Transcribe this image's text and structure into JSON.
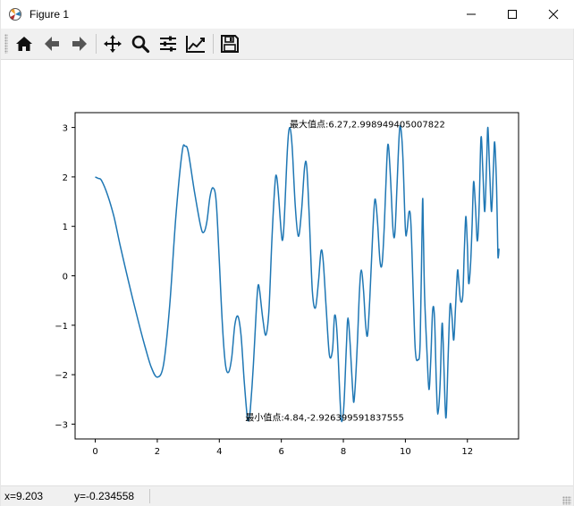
{
  "window": {
    "title": "Figure 1",
    "minimize_symbol": "—",
    "maximize_symbol": "☐",
    "close_symbol": "✕"
  },
  "toolbar": {
    "items": [
      {
        "name": "home-icon",
        "tooltip": ""
      },
      {
        "name": "back-arrow-icon",
        "tooltip": ""
      },
      {
        "name": "forward-arrow-icon",
        "tooltip": ""
      },
      {
        "name": "pan-icon",
        "tooltip": ""
      },
      {
        "name": "zoom-icon",
        "tooltip": ""
      },
      {
        "name": "subplots-config-icon",
        "tooltip": ""
      },
      {
        "name": "edit-axis-icon",
        "tooltip": ""
      },
      {
        "name": "save-icon",
        "tooltip": ""
      }
    ]
  },
  "colors": {
    "line": "#1f77b4",
    "toolbar_bg": "#f0f0f0",
    "axis": "#000000"
  },
  "chart_data": {
    "type": "line",
    "title": "",
    "xlabel": "",
    "ylabel": "",
    "xlim": [
      -0.65,
      13.65
    ],
    "ylim": [
      -3.3,
      3.3
    ],
    "xticks": [
      0,
      2,
      4,
      6,
      8,
      10,
      12
    ],
    "xtick_labels": [
      "0",
      "2",
      "4",
      "6",
      "8",
      "10",
      "12"
    ],
    "yticks": [
      -3,
      -2,
      -1,
      0,
      1,
      2,
      3
    ],
    "ytick_labels": [
      "−3",
      "−2",
      "−1",
      "0",
      "1",
      "2",
      "3"
    ],
    "grid": false,
    "series": [
      {
        "function": "2*cos(x^2/4)+cos(x*x/... )",
        "x_range": [
          0,
          13
        ],
        "points": [
          [
            0.0,
            2.0
          ],
          [
            0.1,
            1.97
          ],
          [
            0.2,
            1.93
          ],
          [
            0.4,
            1.63
          ],
          [
            0.6,
            1.2
          ],
          [
            0.8,
            0.62
          ],
          [
            1.0,
            0.08
          ],
          [
            1.2,
            -0.45
          ],
          [
            1.4,
            -0.95
          ],
          [
            1.6,
            -1.42
          ],
          [
            1.8,
            -1.84
          ],
          [
            2.0,
            -2.05
          ],
          [
            2.2,
            -1.8
          ],
          [
            2.4,
            -0.6
          ],
          [
            2.6,
            1.2
          ],
          [
            2.8,
            2.5
          ],
          [
            2.9,
            2.62
          ],
          [
            3.0,
            2.5
          ],
          [
            3.2,
            1.7
          ],
          [
            3.4,
            1.0
          ],
          [
            3.5,
            0.88
          ],
          [
            3.6,
            1.1
          ],
          [
            3.7,
            1.6
          ],
          [
            3.8,
            1.78
          ],
          [
            3.9,
            1.5
          ],
          [
            4.0,
            0.3
          ],
          [
            4.1,
            -1.0
          ],
          [
            4.2,
            -1.8
          ],
          [
            4.3,
            -1.95
          ],
          [
            4.4,
            -1.65
          ],
          [
            4.5,
            -1.0
          ],
          [
            4.6,
            -0.82
          ],
          [
            4.7,
            -1.2
          ],
          [
            4.8,
            -2.1
          ],
          [
            4.9,
            -2.85
          ],
          [
            4.95,
            -2.9
          ],
          [
            5.0,
            -2.7
          ],
          [
            5.1,
            -1.8
          ],
          [
            5.2,
            -0.6
          ],
          [
            5.25,
            -0.2
          ],
          [
            5.3,
            -0.3
          ],
          [
            5.4,
            -0.85
          ],
          [
            5.5,
            -1.2
          ],
          [
            5.6,
            -0.7
          ],
          [
            5.7,
            0.8
          ],
          [
            5.8,
            1.9
          ],
          [
            5.85,
            2.0
          ],
          [
            5.9,
            1.7
          ],
          [
            6.0,
            0.85
          ],
          [
            6.05,
            0.75
          ],
          [
            6.1,
            1.2
          ],
          [
            6.2,
            2.6
          ],
          [
            6.27,
            3.0
          ],
          [
            6.35,
            2.6
          ],
          [
            6.45,
            1.4
          ],
          [
            6.55,
            0.8
          ],
          [
            6.65,
            1.3
          ],
          [
            6.75,
            2.2
          ],
          [
            6.82,
            2.2
          ],
          [
            6.9,
            1.2
          ],
          [
            7.0,
            -0.3
          ],
          [
            7.1,
            -0.65
          ],
          [
            7.2,
            -0.1
          ],
          [
            7.28,
            0.5
          ],
          [
            7.35,
            0.3
          ],
          [
            7.45,
            -0.7
          ],
          [
            7.55,
            -1.6
          ],
          [
            7.65,
            -1.5
          ],
          [
            7.72,
            -0.8
          ],
          [
            7.8,
            -1.2
          ],
          [
            7.9,
            -2.6
          ],
          [
            7.95,
            -2.95
          ],
          [
            8.02,
            -2.6
          ],
          [
            8.1,
            -1.4
          ],
          [
            8.15,
            -0.85
          ],
          [
            8.22,
            -1.4
          ],
          [
            8.3,
            -2.3
          ],
          [
            8.35,
            -2.5
          ],
          [
            8.45,
            -1.4
          ],
          [
            8.52,
            -0.3
          ],
          [
            8.58,
            0.12
          ],
          [
            8.65,
            -0.3
          ],
          [
            8.72,
            -1.0
          ],
          [
            8.78,
            -1.2
          ],
          [
            8.85,
            -0.5
          ],
          [
            8.95,
            0.9
          ],
          [
            9.02,
            1.55
          ],
          [
            9.1,
            1.1
          ],
          [
            9.18,
            0.3
          ],
          [
            9.25,
            0.25
          ],
          [
            9.32,
            1.0
          ],
          [
            9.4,
            2.3
          ],
          [
            9.45,
            2.65
          ],
          [
            9.52,
            2.0
          ],
          [
            9.6,
            0.95
          ],
          [
            9.66,
            0.85
          ],
          [
            9.73,
            1.8
          ],
          [
            9.8,
            2.85
          ],
          [
            9.85,
            3.0
          ],
          [
            9.92,
            2.4
          ],
          [
            10.0,
            0.95
          ],
          [
            10.05,
            0.9
          ],
          [
            10.12,
            1.3
          ],
          [
            10.18,
            1.05
          ],
          [
            10.25,
            -0.3
          ],
          [
            10.32,
            -1.5
          ],
          [
            10.4,
            -1.7
          ],
          [
            10.48,
            -1.3
          ],
          [
            10.55,
            1.45
          ],
          [
            10.58,
            0.9
          ],
          [
            10.62,
            -0.4
          ],
          [
            10.7,
            -1.6
          ],
          [
            10.76,
            -2.3
          ],
          [
            10.82,
            -1.7
          ],
          [
            10.88,
            -0.7
          ],
          [
            10.94,
            -0.85
          ],
          [
            11.0,
            -2.2
          ],
          [
            11.05,
            -2.8
          ],
          [
            11.12,
            -2.2
          ],
          [
            11.18,
            -1.0
          ],
          [
            11.22,
            -1.35
          ],
          [
            11.28,
            -2.6
          ],
          [
            11.32,
            -2.8
          ],
          [
            11.38,
            -1.6
          ],
          [
            11.44,
            -0.6
          ],
          [
            11.5,
            -0.8
          ],
          [
            11.56,
            -1.3
          ],
          [
            11.62,
            -0.6
          ],
          [
            11.68,
            0.1
          ],
          [
            11.72,
            -0.1
          ],
          [
            11.78,
            -0.5
          ],
          [
            11.85,
            -0.4
          ],
          [
            11.9,
            0.5
          ],
          [
            11.95,
            1.2
          ],
          [
            12.0,
            0.6
          ],
          [
            12.04,
            -0.15
          ],
          [
            12.1,
            0.2
          ],
          [
            12.15,
            1.0
          ],
          [
            12.2,
            1.9
          ],
          [
            12.26,
            1.4
          ],
          [
            12.32,
            0.7
          ],
          [
            12.38,
            1.4
          ],
          [
            12.44,
            2.8
          ],
          [
            12.5,
            2.1
          ],
          [
            12.56,
            1.3
          ],
          [
            12.62,
            2.3
          ],
          [
            12.66,
            3.0
          ],
          [
            12.72,
            2.1
          ],
          [
            12.78,
            1.3
          ],
          [
            12.84,
            2.2
          ],
          [
            12.88,
            2.7
          ],
          [
            12.94,
            1.8
          ],
          [
            12.98,
            0.5
          ],
          [
            13.0,
            0.4
          ],
          [
            13.02,
            0.55
          ]
        ]
      }
    ],
    "annotations": [
      {
        "text": "最大值点:6.27,2.998949405007822",
        "x": 6.27,
        "y": 2.998949405007822
      },
      {
        "text": "最小值点:4.84,-2.926399591837555",
        "x": 4.84,
        "y": -2.926399591837555
      }
    ]
  },
  "status": {
    "x_readout": "x=9.203",
    "y_readout": "y=-0.234558"
  }
}
